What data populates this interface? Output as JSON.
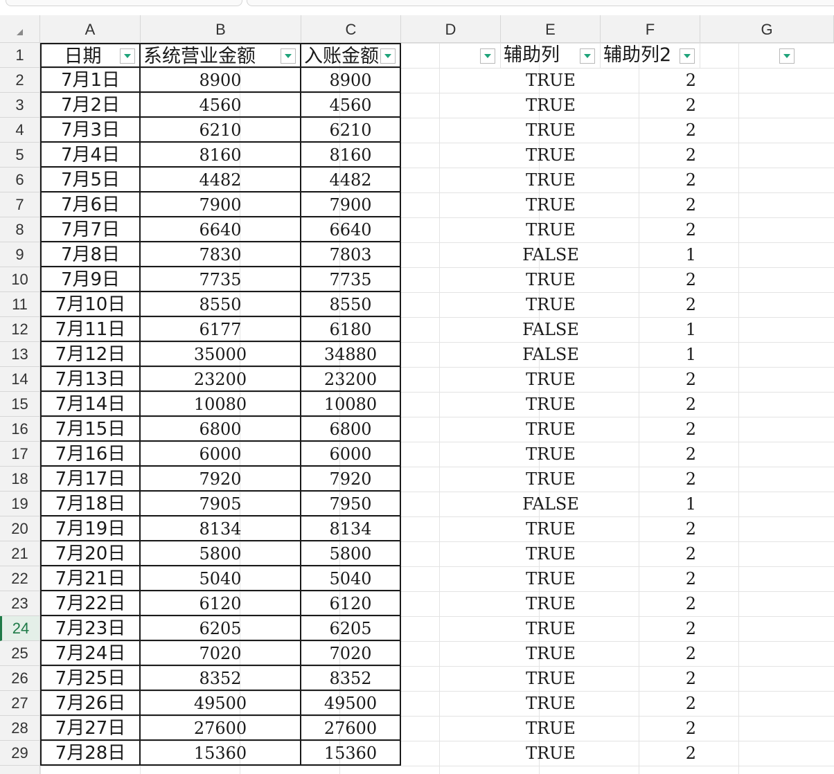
{
  "columns": [
    "A",
    "B",
    "C",
    "D",
    "E",
    "F",
    "G"
  ],
  "header": {
    "a": "日期",
    "b": "系统营业金额",
    "c": "入账金额",
    "d": "",
    "e": "辅助列",
    "f": "辅助列2",
    "g": ""
  },
  "active_row": 24,
  "filter_accent": "#1fa37a",
  "active_color": "#1e7a47",
  "rows": [
    {
      "n": 1
    },
    {
      "n": 2,
      "date": "7月1日",
      "sys": "8900",
      "acct": "8900",
      "flag": "TRUE",
      "aux2": "2"
    },
    {
      "n": 3,
      "date": "7月2日",
      "sys": "4560",
      "acct": "4560",
      "flag": "TRUE",
      "aux2": "2"
    },
    {
      "n": 4,
      "date": "7月3日",
      "sys": "6210",
      "acct": "6210",
      "flag": "TRUE",
      "aux2": "2"
    },
    {
      "n": 5,
      "date": "7月4日",
      "sys": "8160",
      "acct": "8160",
      "flag": "TRUE",
      "aux2": "2"
    },
    {
      "n": 6,
      "date": "7月5日",
      "sys": "4482",
      "acct": "4482",
      "flag": "TRUE",
      "aux2": "2"
    },
    {
      "n": 7,
      "date": "7月6日",
      "sys": "7900",
      "acct": "7900",
      "flag": "TRUE",
      "aux2": "2"
    },
    {
      "n": 8,
      "date": "7月7日",
      "sys": "6640",
      "acct": "6640",
      "flag": "TRUE",
      "aux2": "2"
    },
    {
      "n": 9,
      "date": "7月8日",
      "sys": "7830",
      "acct": "7803",
      "flag": "FALSE",
      "aux2": "1"
    },
    {
      "n": 10,
      "date": "7月9日",
      "sys": "7735",
      "acct": "7735",
      "flag": "TRUE",
      "aux2": "2"
    },
    {
      "n": 11,
      "date": "7月10日",
      "sys": "8550",
      "acct": "8550",
      "flag": "TRUE",
      "aux2": "2"
    },
    {
      "n": 12,
      "date": "7月11日",
      "sys": "6177",
      "acct": "6180",
      "flag": "FALSE",
      "aux2": "1"
    },
    {
      "n": 13,
      "date": "7月12日",
      "sys": "35000",
      "acct": "34880",
      "flag": "FALSE",
      "aux2": "1"
    },
    {
      "n": 14,
      "date": "7月13日",
      "sys": "23200",
      "acct": "23200",
      "flag": "TRUE",
      "aux2": "2"
    },
    {
      "n": 15,
      "date": "7月14日",
      "sys": "10080",
      "acct": "10080",
      "flag": "TRUE",
      "aux2": "2"
    },
    {
      "n": 16,
      "date": "7月15日",
      "sys": "6800",
      "acct": "6800",
      "flag": "TRUE",
      "aux2": "2"
    },
    {
      "n": 17,
      "date": "7月16日",
      "sys": "6000",
      "acct": "6000",
      "flag": "TRUE",
      "aux2": "2"
    },
    {
      "n": 18,
      "date": "7月17日",
      "sys": "7920",
      "acct": "7920",
      "flag": "TRUE",
      "aux2": "2"
    },
    {
      "n": 19,
      "date": "7月18日",
      "sys": "7905",
      "acct": "7950",
      "flag": "FALSE",
      "aux2": "1"
    },
    {
      "n": 20,
      "date": "7月19日",
      "sys": "8134",
      "acct": "8134",
      "flag": "TRUE",
      "aux2": "2"
    },
    {
      "n": 21,
      "date": "7月20日",
      "sys": "5800",
      "acct": "5800",
      "flag": "TRUE",
      "aux2": "2"
    },
    {
      "n": 22,
      "date": "7月21日",
      "sys": "5040",
      "acct": "5040",
      "flag": "TRUE",
      "aux2": "2"
    },
    {
      "n": 23,
      "date": "7月22日",
      "sys": "6120",
      "acct": "6120",
      "flag": "TRUE",
      "aux2": "2"
    },
    {
      "n": 24,
      "date": "7月23日",
      "sys": "6205",
      "acct": "6205",
      "flag": "TRUE",
      "aux2": "2"
    },
    {
      "n": 25,
      "date": "7月24日",
      "sys": "7020",
      "acct": "7020",
      "flag": "TRUE",
      "aux2": "2"
    },
    {
      "n": 26,
      "date": "7月25日",
      "sys": "8352",
      "acct": "8352",
      "flag": "TRUE",
      "aux2": "2"
    },
    {
      "n": 27,
      "date": "7月26日",
      "sys": "49500",
      "acct": "49500",
      "flag": "TRUE",
      "aux2": "2"
    },
    {
      "n": 28,
      "date": "7月27日",
      "sys": "27600",
      "acct": "27600",
      "flag": "TRUE",
      "aux2": "2"
    },
    {
      "n": 29,
      "date": "7月28日",
      "sys": "15360",
      "acct": "15360",
      "flag": "TRUE",
      "aux2": "2"
    }
  ]
}
